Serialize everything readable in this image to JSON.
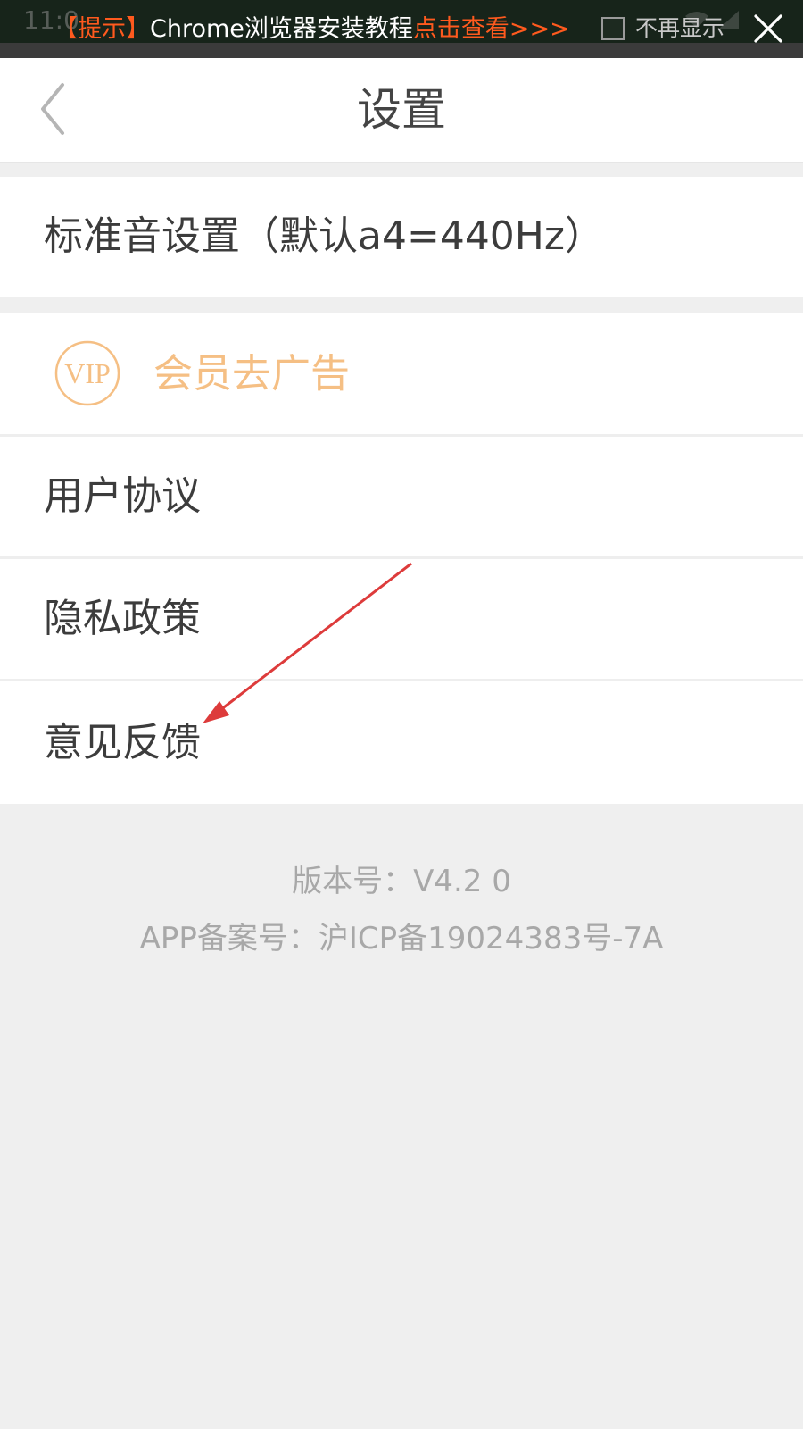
{
  "banner": {
    "clock": "11:0",
    "tag": "【提示】",
    "message": "Chrome浏览器安装教程",
    "link": "点击查看>>>",
    "dont_show_label": "不再显示",
    "close_icon": "close-icon"
  },
  "navbar": {
    "back_icon": "chevron-left-icon",
    "title": "设置"
  },
  "settings": {
    "standard_pitch": "标准音设置（默认a4=440Hz）",
    "vip": {
      "badge_text": "VIP",
      "label": "会员去广告",
      "color": "#f5bf84"
    },
    "user_agreement": "用户协议",
    "privacy_policy": "隐私政策",
    "feedback": "意见反馈"
  },
  "footer": {
    "version": "版本号：V4.2  0",
    "icp": "APP备案号：沪ICP备19024383号-7A"
  },
  "colors": {
    "banner_bg": "#17241a",
    "banner_accent": "#ff5a1e",
    "page_bg": "#efefef",
    "annotation_arrow": "#dd3b3b"
  }
}
